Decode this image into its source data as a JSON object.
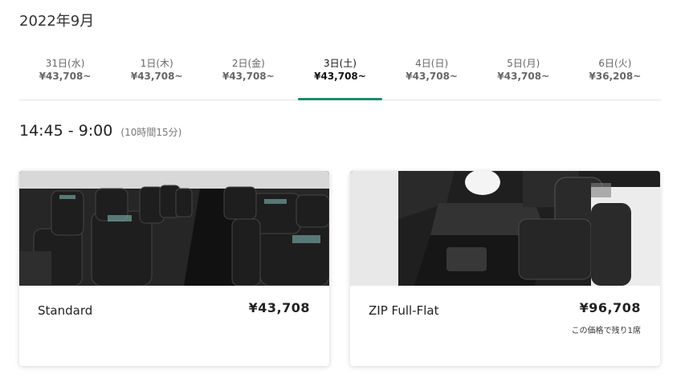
{
  "month_title": "2022年9月",
  "dates": [
    {
      "date": "31日(水)",
      "price": "¥43,708~",
      "active": false
    },
    {
      "date": "1日(木)",
      "price": "¥43,708~",
      "active": false
    },
    {
      "date": "2日(金)",
      "price": "¥43,708~",
      "active": false
    },
    {
      "date": "3日(土)",
      "price": "¥43,708~",
      "active": true
    },
    {
      "date": "4日(日)",
      "price": "¥43,708~",
      "active": false
    },
    {
      "date": "5日(月)",
      "price": "¥43,708~",
      "active": false
    },
    {
      "date": "6日(火)",
      "price": "¥36,208~",
      "active": false
    }
  ],
  "flight": {
    "time_range": "14:45 - 9:00",
    "duration": "(10時間15分)"
  },
  "fares": [
    {
      "name": "Standard",
      "price": "¥43,708",
      "note": ""
    },
    {
      "name": "ZIP Full-Flat",
      "price": "¥96,708",
      "note": "この価格で残り1席"
    }
  ],
  "colors": {
    "accent": "#1c8c6c"
  }
}
